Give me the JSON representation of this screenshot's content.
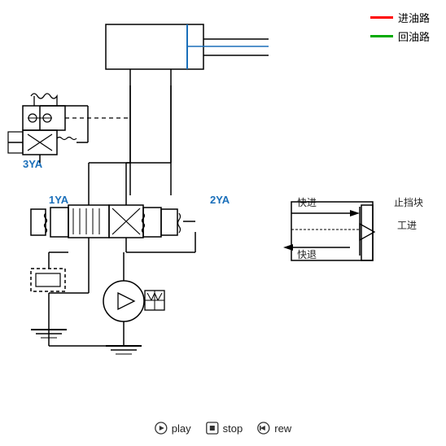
{
  "legend": {
    "oil_in_label": "进油路",
    "oil_out_label": "回油路",
    "oil_in_color": "#ff0000",
    "oil_out_color": "#00aa00"
  },
  "labels": {
    "ya3": "3YA",
    "ya1": "1YA",
    "ya2": "2YA",
    "kuaijin": "快进",
    "zhidang": "止挡块",
    "gongjin": "工进",
    "kuaitui": "快退"
  },
  "controls": {
    "play": "play",
    "stop": "stop",
    "rew": "rew"
  }
}
